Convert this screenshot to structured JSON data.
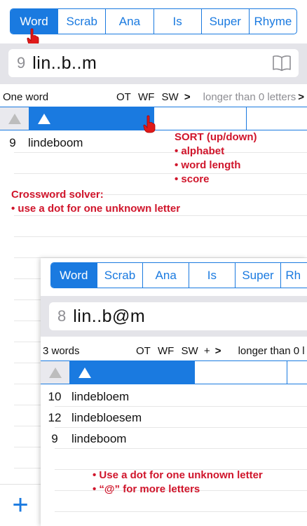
{
  "main": {
    "tabs": [
      {
        "label": "Word",
        "active": true
      },
      {
        "label": "Scrab",
        "active": false
      },
      {
        "label": "Ana",
        "active": false
      },
      {
        "label": "Is",
        "active": false
      },
      {
        "label": "Super",
        "active": false
      },
      {
        "label": "Rhyme",
        "active": false
      }
    ],
    "search": {
      "count": "9",
      "query": "lin..b..m"
    },
    "info": {
      "words": "One word",
      "ot": "OT",
      "wf": "WF",
      "sw": "SW",
      "chev": ">",
      "longer": "longer than 0 letters",
      "chev2": ">"
    },
    "rows": [
      {
        "num": "9",
        "word": "lindeboom"
      }
    ],
    "notes": {
      "sort_title": "SORT (up/down)",
      "sort_1": "• alphabet",
      "sort_2": "• word length",
      "sort_3": "• score",
      "cross_title": "Crossword solver:",
      "cross_1": "• use a dot for one unknown letter"
    },
    "plus_label": "+"
  },
  "inset": {
    "tabs": [
      {
        "label": "Word",
        "active": true
      },
      {
        "label": "Scrab",
        "active": false
      },
      {
        "label": "Ana",
        "active": false
      },
      {
        "label": "Is",
        "active": false
      },
      {
        "label": "Super",
        "active": false
      },
      {
        "label": "Rh",
        "active": false
      }
    ],
    "search": {
      "count": "8",
      "query": "lin..b@m"
    },
    "info": {
      "words": "3 words",
      "ot": "OT",
      "wf": "WF",
      "sw": "SW",
      "plus": "+",
      "chev": ">",
      "longer": "longer than 0 l"
    },
    "rows": [
      {
        "num": "10",
        "word": "lindebloem"
      },
      {
        "num": "12",
        "word": "lindebloesem"
      },
      {
        "num": "9",
        "word": "lindeboom"
      }
    ],
    "notes": {
      "dot": "• Use a dot for one unknown letter",
      "at": "• “@” for more letters"
    }
  },
  "colors": {
    "accent": "#1a7ae0",
    "annotation": "#d0152b",
    "search_bg": "#e4e4e9"
  },
  "icons": {
    "book": "book-icon",
    "pointer": "pointing-hand-icon",
    "sort": "triangle-up-icon"
  }
}
